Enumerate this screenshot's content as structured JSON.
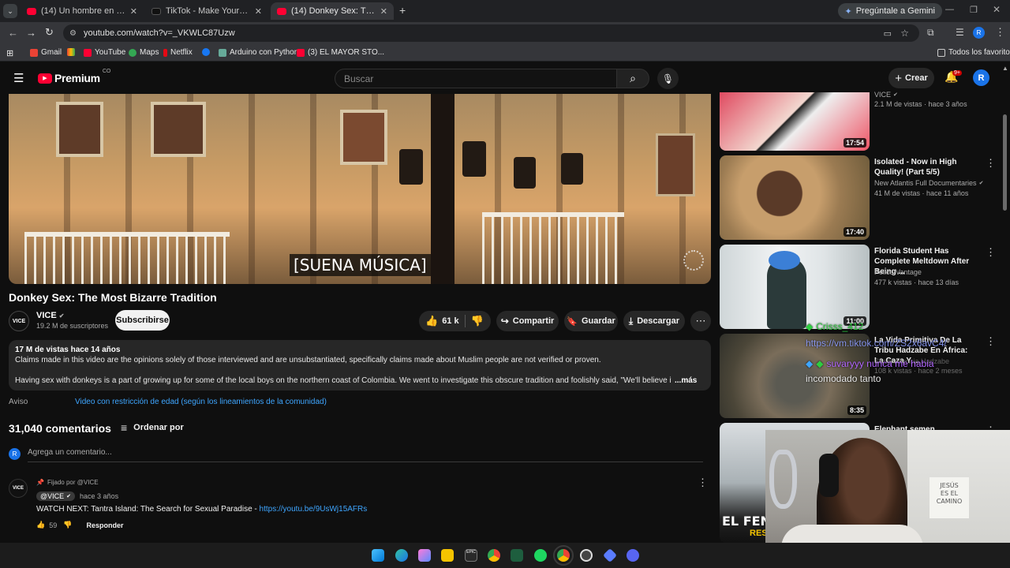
{
  "browser": {
    "tabs": [
      {
        "title": "(14) Un hombre en Ecuador del"
      },
      {
        "title": "TikTok - Make Your Day"
      },
      {
        "title": "(14) Donkey Sex: The Most Bizarre"
      }
    ],
    "gemini_label": "Pregúntale a Gemini",
    "url": "youtube.com/watch?v=_VKWLC87Uzw",
    "bookmarks": [
      "Gmail",
      "YouTube",
      "Maps",
      "Netflix",
      "Arduino con Python.",
      "(3) EL MAYOR STO..."
    ],
    "all_bookmarks": "Todos los favoritos"
  },
  "yt": {
    "logo": "Premium",
    "region": "CO",
    "search_placeholder": "Buscar",
    "create_label": "Crear",
    "notif_badge": "9+",
    "avatar_letter": "R"
  },
  "video": {
    "subtitle": "[SUENA MÚSICA]",
    "title": "Donkey Sex: The Most Bizarre Tradition",
    "channel": "VICE",
    "subscribers": "19.2 M de suscriptores",
    "subscribe_label": "Subscribirse",
    "likes": "61 k",
    "share_label": "Compartir",
    "save_label": "Guardar",
    "download_label": "Descargar",
    "views_age": "17 M de vistas  hace 14 años",
    "desc_line1": "Claims made in this video are the opinions solely of those interviewed and are unsubstantiated, specifically claims made about Muslim people are not verified or proven.",
    "desc_line2": "Having sex with donkeys is a part of growing up for some of the local boys on the northern coast of Colombia. We went to investigate this obscure tradition and foolishly said, \"We'll believe it when we see it",
    "more_label": "...más",
    "notice_label": "Aviso",
    "notice_text": "Video con restricción de edad (según los lineamientos de la comunidad)"
  },
  "comments": {
    "count": "31,040 comentarios",
    "sort_label": "Ordenar por",
    "add_placeholder": "Agrega un comentario...",
    "pinned_label": "Fijado por @VICE",
    "author": "@VICE",
    "age": "hace 3 años",
    "text": "WATCH NEXT: Tantra Island: The Search for Sexual Paradise - ",
    "link": "https://youtu.be/9UsWj15AFRs",
    "likes": "59",
    "reply_label": "Responder"
  },
  "sidebar": [
    {
      "title": "",
      "channel": "VICE",
      "meta": "2.1 M de vistas · hace 3 años",
      "duration": "17:54"
    },
    {
      "title": "Isolated - Now in High Quality! (Part 5/5)",
      "channel": "New Atlantis Full Documentaries",
      "meta": "41 M de vistas · hace 11 años",
      "duration": "17:40"
    },
    {
      "title": "Florida Student Has Complete Meltdown After Being ...",
      "channel": "Police Vantage",
      "meta": "477 k vistas · hace 13 días",
      "duration": "11:00"
    },
    {
      "title": "La Vida Primitiva De La Tribu Hadzabe En África: La Caza Y ...",
      "channel": "Supervivencia Hadzabe",
      "meta": "108 k vistas · hace 2 meses",
      "duration": "8:35"
    },
    {
      "title": "Elephant semen",
      "channel": "",
      "meta": "",
      "duration": ""
    }
  ],
  "overlay": {
    "user1": "Crisss_412",
    "url_text": "https://vm.tiktok.com/ZS2x6avC4/",
    "user2": "suvaryyy nunca me habia",
    "msg2": "incomodado tanto",
    "thumb_text": "EL FENÓ",
    "thumb_text2": "RES",
    "sign": "JESÚS\nES EL\nCAMINO"
  },
  "colors": {
    "accent": "#ff0033",
    "link": "#3ea6ff",
    "bg": "#0f0f0f",
    "green": "#2ecc40",
    "purple": "#b266ff"
  }
}
